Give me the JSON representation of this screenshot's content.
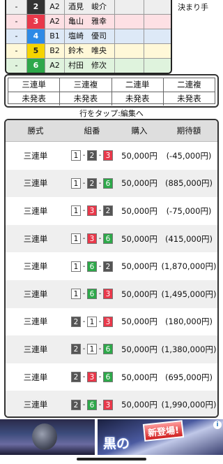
{
  "racers": [
    {
      "dash": "-",
      "num": "2",
      "num_color": "#333333",
      "num_text": "#ffffff",
      "rank": "A2",
      "name": "酒見　峻介",
      "row_bg": "#eeeeee"
    },
    {
      "dash": "-",
      "num": "3",
      "num_color": "#e8384a",
      "num_text": "#ffffff",
      "rank": "A2",
      "name": "亀山　雅幸",
      "row_bg": "#fde0e4"
    },
    {
      "dash": "-",
      "num": "4",
      "num_color": "#2e8ae6",
      "num_text": "#ffffff",
      "rank": "B1",
      "name": "塩崎　優司",
      "row_bg": "#dde9f7"
    },
    {
      "dash": "-",
      "num": "5",
      "num_color": "#f5d400",
      "num_text": "#222222",
      "rank": "B2",
      "name": "鈴木　唯央",
      "row_bg": "#fff8d8"
    },
    {
      "dash": "-",
      "num": "6",
      "num_color": "#2ea84a",
      "num_text": "#ffffff",
      "rank": "A2",
      "name": "村田　修次",
      "row_bg": "#dff3dd"
    }
  ],
  "kimarite_label": "決まり手",
  "status": {
    "headers": [
      "三連単",
      "三連複",
      "二連単",
      "二連複"
    ],
    "values": [
      "未発表",
      "未発表",
      "未発表",
      "未発表"
    ]
  },
  "tap_hint": "行をタップ:編集へ",
  "bets_header": {
    "type": "勝式",
    "combo": "組番",
    "amount": "購入",
    "expected": "期待額"
  },
  "boat_colors": {
    "1": {
      "bg": "#ffffff",
      "fg": "#111111"
    },
    "2": {
      "bg": "#555555",
      "fg": "#ffffff"
    },
    "3": {
      "bg": "#e8384a",
      "fg": "#ffffff"
    },
    "6": {
      "bg": "#2ea84a",
      "fg": "#ffffff"
    }
  },
  "bets": [
    {
      "type": "三連単",
      "combo": [
        "1",
        "2",
        "3"
      ],
      "amount": "50,000円",
      "expected": "(-45,000円)"
    },
    {
      "type": "三連単",
      "combo": [
        "1",
        "2",
        "6"
      ],
      "amount": "50,000円",
      "expected": "(885,000円)"
    },
    {
      "type": "三連単",
      "combo": [
        "1",
        "3",
        "2"
      ],
      "amount": "50,000円",
      "expected": "(-75,000円)"
    },
    {
      "type": "三連単",
      "combo": [
        "1",
        "3",
        "6"
      ],
      "amount": "50,000円",
      "expected": "(415,000円)"
    },
    {
      "type": "三連単",
      "combo": [
        "1",
        "6",
        "2"
      ],
      "amount": "50,000円",
      "expected": "(1,870,000円)"
    },
    {
      "type": "三連単",
      "combo": [
        "1",
        "6",
        "3"
      ],
      "amount": "50,000円",
      "expected": "(1,495,000円)"
    },
    {
      "type": "三連単",
      "combo": [
        "2",
        "1",
        "3"
      ],
      "amount": "50,000円",
      "expected": "(180,000円)"
    },
    {
      "type": "三連単",
      "combo": [
        "2",
        "1",
        "6"
      ],
      "amount": "50,000円",
      "expected": "(1,380,000円)"
    },
    {
      "type": "三連単",
      "combo": [
        "2",
        "3",
        "6"
      ],
      "amount": "50,000円",
      "expected": "(695,000円)"
    },
    {
      "type": "三連単",
      "combo": [
        "2",
        "6",
        "3"
      ],
      "amount": "50,000円",
      "expected": "(1,990,000円)"
    }
  ],
  "ad": {
    "badge": "新登場!",
    "title": "黒の",
    "info": "i"
  }
}
